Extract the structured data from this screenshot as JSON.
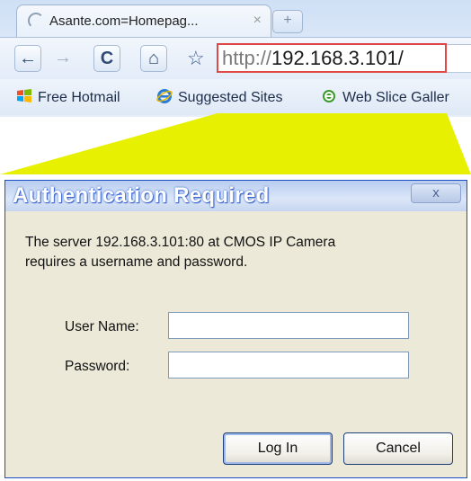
{
  "browser": {
    "tab": {
      "title": "Asante.com=Homepag...",
      "close": "×"
    },
    "new_tab": "+",
    "nav": {
      "back": "←",
      "forward": "→",
      "reload": "C",
      "home": "⌂",
      "star": "☆"
    },
    "url": {
      "protocol": "http://",
      "host": "192.168.3.101/"
    },
    "bookmarks": [
      {
        "label": "Free Hotmail",
        "icon": "windows-flag-icon"
      },
      {
        "label": "Suggested Sites",
        "icon": "ie-icon"
      },
      {
        "label": "Web Slice Galler",
        "icon": "web-slice-icon"
      }
    ]
  },
  "dialog": {
    "title": "Authentication Required",
    "close": "x",
    "message_line1": "The server 192.168.3.101:80 at CMOS IP Camera",
    "message_line2": "requires a username and password.",
    "username_label": "User Name:",
    "password_label": "Password:",
    "username_value": "",
    "password_value": "",
    "login_label": "Log In",
    "cancel_label": "Cancel"
  },
  "colors": {
    "callout": "#e6f000",
    "highlight_border": "#e04848",
    "dialog_bg": "#ece9d8"
  }
}
